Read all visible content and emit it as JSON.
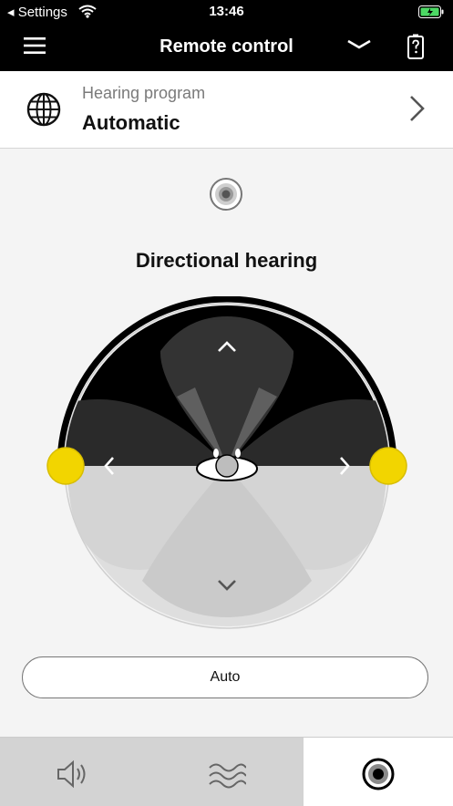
{
  "status_bar": {
    "back_label": "◂ Settings",
    "time": "13:46"
  },
  "nav": {
    "title": "Remote control"
  },
  "program": {
    "label": "Hearing program",
    "value": "Automatic"
  },
  "main": {
    "heading": "Directional hearing",
    "auto_button": "Auto"
  },
  "colors": {
    "accent_yellow": "#f2d500",
    "battery_green": "#4cd964"
  },
  "icons": [
    "menu-icon",
    "collapse-chevron-icon",
    "battery-icon",
    "globe-icon",
    "chevron-right-icon",
    "directional-mode-icon",
    "volume-icon",
    "sound-wave-icon",
    "directional-tab-icon"
  ]
}
